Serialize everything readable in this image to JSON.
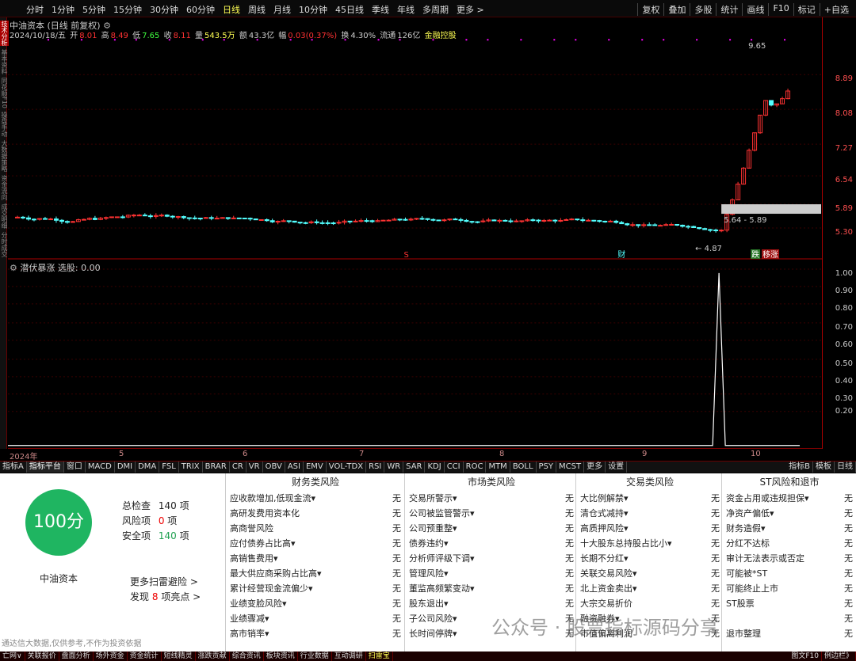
{
  "toolbar": {
    "periods": [
      "分时",
      "1分钟",
      "5分钟",
      "15分钟",
      "30分钟",
      "60分钟",
      "日线",
      "周线",
      "月线",
      "10分钟",
      "45日线",
      "季线",
      "年线",
      "多周期",
      "更多 >"
    ],
    "active_period": "日线",
    "right": [
      "复权",
      "叠加",
      "多股",
      "统计",
      "画线",
      "F10",
      "标记",
      "+自选"
    ]
  },
  "left_tabs": [
    "技术分析",
    "基本资料",
    "同花顺F10",
    "操盘手动",
    "大数据策略",
    "资金流向",
    "成交明细",
    "分时成交"
  ],
  "stock": {
    "title": "中油资本 (日线 前复权)",
    "date": "2024/10/18/五",
    "open_label": "开",
    "open": "8.01",
    "high_label": "高",
    "high": "8.49",
    "low_label": "低",
    "low": "7.65",
    "close_label": "收",
    "close": "8.11",
    "volume_label": "量",
    "volume": "543.5万",
    "amount_label": "额",
    "amount": "43.3亿",
    "change_label": "幅",
    "change": "0.03(0.37%)",
    "turnover_label": "换",
    "turnover": "4.30%",
    "float_label": "流通",
    "float": "126亿",
    "tag": "金融控股"
  },
  "price_axis": [
    "8.89",
    "8.08",
    "7.27",
    "6.54",
    "5.89",
    "5.30"
  ],
  "annotations": {
    "high_mark": "9.65",
    "low_mark": "4.87",
    "range_box": "5.64 - 5.89",
    "finance_tag": "财",
    "s_tag": "S",
    "die_tag": "跌",
    "limit_tag": "移涨"
  },
  "indicator": {
    "title": "潜伏暴涨",
    "value_label": "选股: 0.00",
    "axis": [
      "1.00",
      "0.90",
      "0.80",
      "0.70",
      "0.60",
      "0.50",
      "0.40",
      "0.30",
      "0.20"
    ]
  },
  "date_axis": [
    "2024年",
    "5",
    "6",
    "7",
    "8",
    "9",
    "10"
  ],
  "bottom_tabs": [
    "指标A",
    "指标平台",
    "窗口",
    "MACD",
    "DMI",
    "DMA",
    "FSL",
    "TRIX",
    "BRAR",
    "CR",
    "VR",
    "OBV",
    "ASI",
    "EMV",
    "VOL-TDX",
    "RSI",
    "WR",
    "SAR",
    "KDJ",
    "CCI",
    "ROC",
    "MTM",
    "BOLL",
    "PSY",
    "MCST",
    "更多",
    "设置"
  ],
  "bottom_right_tabs": [
    "指标B",
    "模板",
    "日线"
  ],
  "risk": {
    "score": "100分",
    "stock_name": "中油资本",
    "checks_label": "总检查",
    "checks": "140",
    "checks_unit": "项",
    "risk_label": "风险项",
    "risk_count": "0",
    "risk_unit": "项",
    "safe_label": "安全项",
    "safe_count": "140",
    "safe_unit": "项",
    "more_link": "更多扫雷避险 >",
    "found_prefix": "发现",
    "found_count": "8",
    "found_suffix": "项亮点 >",
    "columns": [
      {
        "title": "财务类风险",
        "items": [
          "应收款增加,低现金流▾",
          "高研发费用资本化",
          "高商誉风险",
          "应付债券占比高▾",
          "高销售费用▾",
          "最大供应商采购占比高▾",
          "累计经营现金流偏少▾",
          "业绩变脸风险▾",
          "业绩骤减▾",
          "高市销率▾"
        ]
      },
      {
        "title": "市场类风险",
        "items": [
          "交易所警示▾",
          "公司被监管警示▾",
          "公司预重整▾",
          "债券违约▾",
          "分析师评级下调▾",
          "管理风险▾",
          "董监高频繁变动▾",
          "股东退出▾",
          "子公司风险▾",
          "长时间停牌▾"
        ]
      },
      {
        "title": "交易类风险",
        "items": [
          "大比例解禁▾",
          "清仓式减持▾",
          "高质押风险▾",
          "十大股东总持股占比小▾",
          "长期不分红▾",
          "关联交易风险▾",
          "北上资金卖出▾",
          "大宗交易折价",
          "融资融券▾",
          "市值偏离利润"
        ]
      },
      {
        "title": "ST风险和退市",
        "items": [
          "资金占用或违规担保▾",
          "净资产偏低▾",
          "财务造假▾",
          "分红不达标",
          "审计无法表示或否定",
          "可能被*ST",
          "可能终止上市",
          "ST股票",
          "",
          "退市整理"
        ]
      }
    ],
    "none_text": "无"
  },
  "disclaimer": "通达信大数据,仅供参考,不作为投资依据",
  "watermark": "公众号 · 股票指标源码分享",
  "status_bar": [
    "亡网∨",
    "关联报价",
    "盘面分析",
    "场外资金",
    "资金统计",
    "短线精灵",
    "涨跌贡献",
    "综合资讯",
    "板块资讯",
    "行业数据",
    "互动调研",
    "扫雷宝"
  ],
  "status_right": [
    "图文F10",
    "例边栏》"
  ],
  "colors": {
    "up": "#ff3232",
    "down": "#54ffff",
    "accent": "#ffff54",
    "score_bg": "#1fb561"
  }
}
